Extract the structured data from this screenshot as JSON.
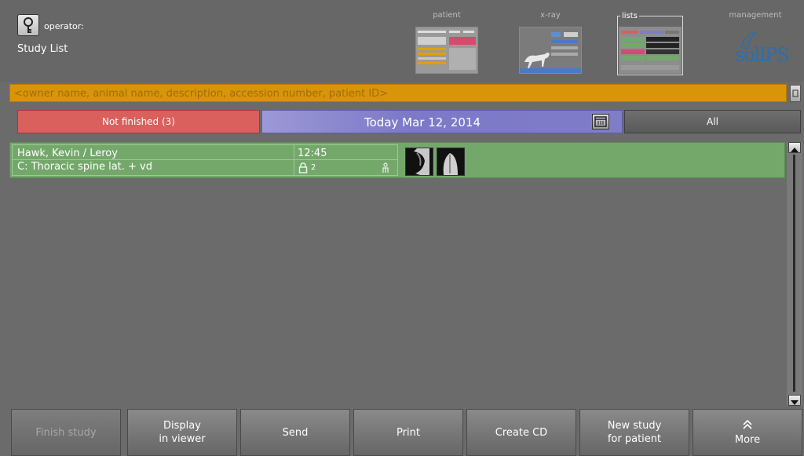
{
  "header": {
    "operator_label": "operator:",
    "screen_title": "Study List"
  },
  "nav_tabs": [
    {
      "label": "patient",
      "active": false
    },
    {
      "label": "x-ray",
      "active": false
    },
    {
      "label": "lists",
      "active": true
    },
    {
      "label": "management",
      "active": false
    }
  ],
  "logo_text": "sollPS",
  "search": {
    "placeholder": "<owner name, animal name, description, accession number, patient ID>",
    "value": ""
  },
  "filters": {
    "not_finished": "Not finished (3)",
    "date": "Today Mar 12, 2014",
    "all": "All"
  },
  "studies": [
    {
      "name": "Hawk, Kevin / Leroy",
      "description": "C: Thoracic spine lat. + vd",
      "time": "12:45",
      "image_count": "2"
    }
  ],
  "toolbar": {
    "finish_study": "Finish study",
    "display_viewer_line1": "Display",
    "display_viewer_line2": "in viewer",
    "send": "Send",
    "print": "Print",
    "create_cd": "Create CD",
    "new_study_line1": "New study",
    "new_study_line2": "for patient",
    "more": "More"
  },
  "colors": {
    "search_bar": "#d8950a",
    "not_finished": "#d9605d",
    "date_filter": "#7f7cc8",
    "study_row": "#74a86b"
  }
}
